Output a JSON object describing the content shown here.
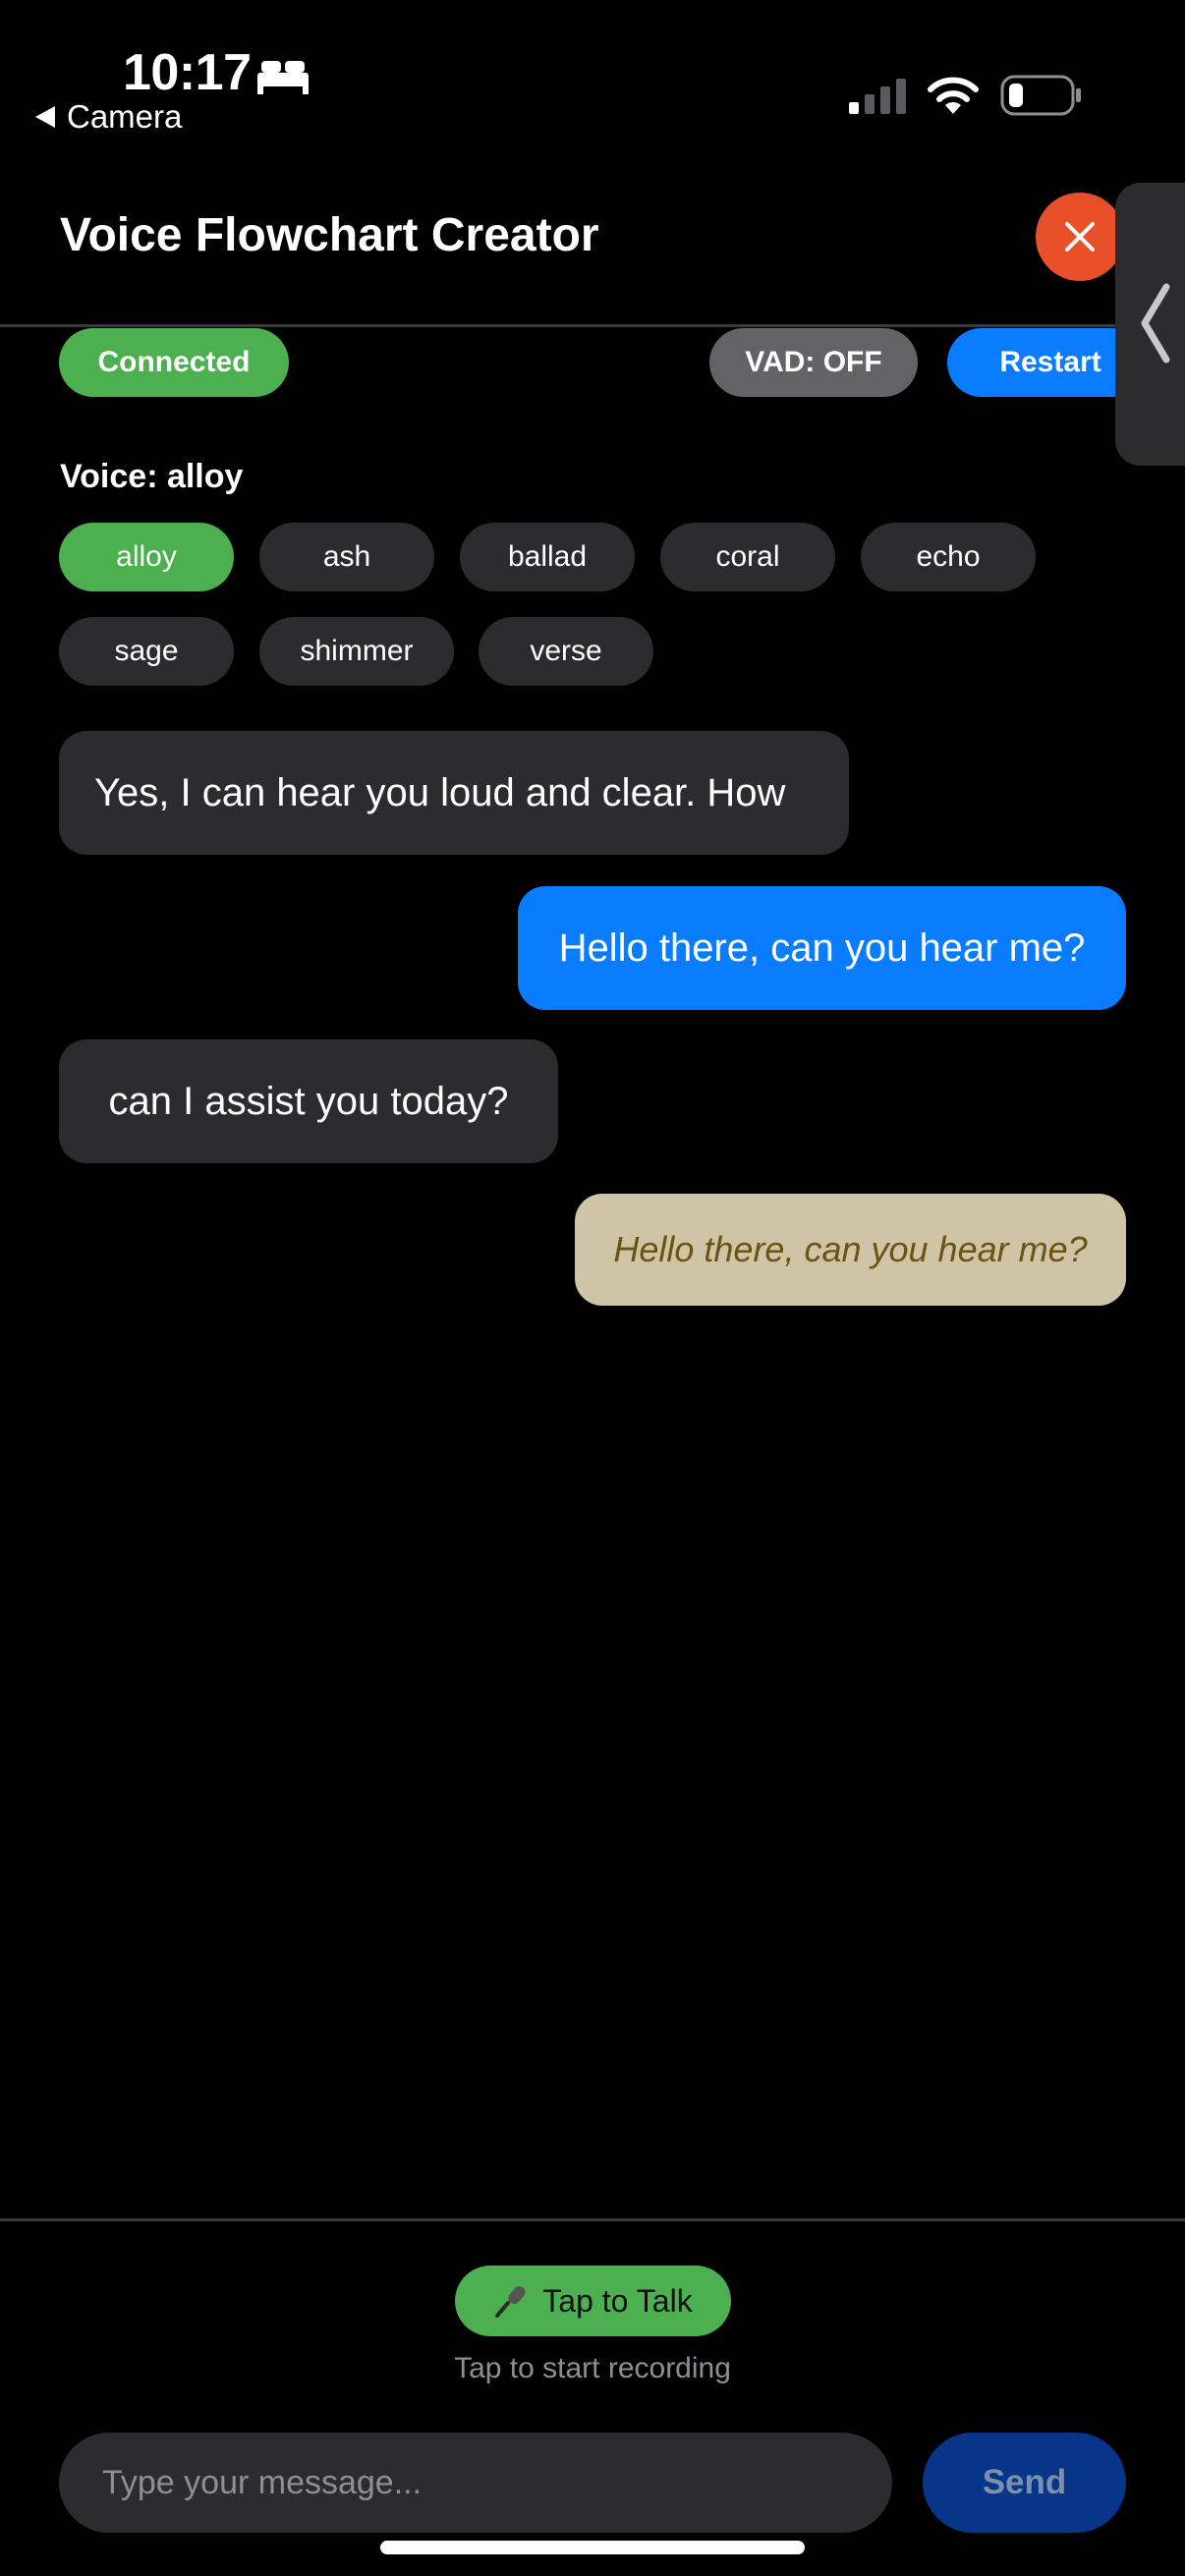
{
  "status_bar": {
    "time": "10:17",
    "back_label": "Camera",
    "icons": [
      "bed-icon",
      "signal-icon",
      "wifi-icon",
      "battery-icon"
    ]
  },
  "header": {
    "title": "Voice Flowchart Creator",
    "close_icon": "close-icon"
  },
  "controls": {
    "connection_status": "Connected",
    "vad_label": "VAD: OFF",
    "restart_label": "Restart"
  },
  "voice": {
    "label": "Voice: alloy",
    "options": [
      "alloy",
      "ash",
      "ballad",
      "coral",
      "echo",
      "sage",
      "shimmer",
      "verse"
    ],
    "selected": "alloy"
  },
  "messages": [
    {
      "role": "assistant",
      "text": "Yes, I can hear you loud and clear. How"
    },
    {
      "role": "user",
      "text": "Hello there, can you hear me?"
    },
    {
      "role": "assistant",
      "text": "can I assist you today?"
    },
    {
      "role": "user-pending",
      "text": "Hello there, can you hear me?"
    }
  ],
  "talk": {
    "button_label": "Tap to Talk",
    "icon": "microphone-icon",
    "hint": "Tap to start recording"
  },
  "composer": {
    "placeholder": "Type your message...",
    "value": "",
    "send_label": "Send"
  },
  "colors": {
    "accent_green": "#4caf50",
    "accent_blue": "#0a7cff",
    "close_red": "#e8502a",
    "pending_bubble": "#cfc4a6"
  }
}
